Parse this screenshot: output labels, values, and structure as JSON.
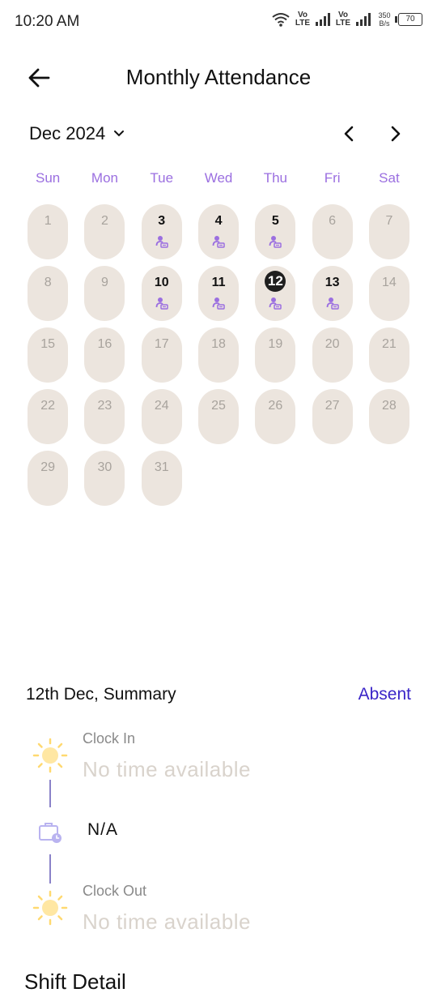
{
  "status_bar": {
    "time": "10:20 AM",
    "sim1_label": "Vo LTE",
    "sim2_label": "Vo LTE",
    "speed": "350 B/s",
    "battery": "70"
  },
  "header": {
    "title": "Monthly Attendance"
  },
  "calendar": {
    "month_label": "Dec 2024",
    "weekdays": [
      "Sun",
      "Mon",
      "Tue",
      "Wed",
      "Thu",
      "Fri",
      "Sat"
    ],
    "days": [
      "1",
      "2",
      "3",
      "4",
      "5",
      "6",
      "7",
      "8",
      "9",
      "10",
      "11",
      "12",
      "13",
      "14",
      "15",
      "16",
      "17",
      "18",
      "19",
      "20",
      "21",
      "22",
      "23",
      "24",
      "25",
      "26",
      "27",
      "28",
      "29",
      "30",
      "31"
    ],
    "present_days": [
      3,
      4,
      5,
      10,
      11,
      12,
      13
    ],
    "selected_day": 12,
    "accent_color": "#9b6fe0"
  },
  "summary": {
    "title": "12th Dec, Summary",
    "status": "Absent",
    "clock_in_label": "Clock In",
    "clock_in_value": "No time available",
    "duration_value": "N/A",
    "clock_out_label": "Clock Out",
    "clock_out_value": "No time available"
  },
  "shift": {
    "title": "Shift Detail"
  }
}
